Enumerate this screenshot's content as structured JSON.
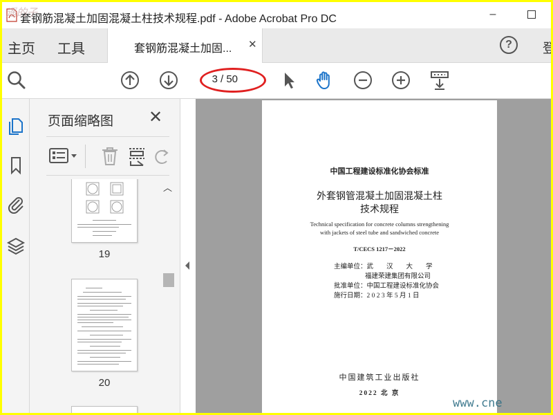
{
  "window": {
    "title": "套钢筋混凝土加固混凝土柱技术规程.pdf - Adobe Acrobat Pro DC",
    "minimize_glyph": "–",
    "watermark_left": "遥的子"
  },
  "tabs": {
    "home": "主页",
    "tools": "工具",
    "document_tab": "套钢筋混凝土加固...",
    "close_glyph": "✕",
    "help_glyph": "?",
    "signin_partial": "登"
  },
  "toolbar": {
    "page_current": "3",
    "page_total": "/ 50",
    "icons": [
      "search-icon",
      "page-up-icon",
      "page-down-icon",
      "select-cursor-icon",
      "hand-tool-icon",
      "zoom-out-icon",
      "zoom-in-icon",
      "scroll-mode-icon"
    ],
    "accent_color": "#1a73c9",
    "highlight_color": "#e02020"
  },
  "rail": {
    "icons": [
      "pages-icon",
      "bookmark-icon",
      "attachment-icon",
      "layers-icon"
    ]
  },
  "thumbnails": {
    "title": "页面缩略图",
    "close_glyph": "✕",
    "pages": [
      {
        "number": "19"
      },
      {
        "number": "20"
      }
    ]
  },
  "document": {
    "association": "中国工程建设标准化协会标准",
    "title_line1": "外套钢管混凝土加固混凝土柱",
    "title_line2": "技术规程",
    "english_line1": "Technical specification for concrete columns strengthening",
    "english_line2": "with jackets of steel tube and sandwiched concrete",
    "code": "T/CECS 1217－2022",
    "editor_label": "主编单位：",
    "editor_1": "武　　汉　　大　　学",
    "editor_2": "福建荣建集团有限公司",
    "approver_label": "批准单位：",
    "approver": "中国工程建设标准化协会",
    "date_label": "施行日期：",
    "date": "2 0 2 3 年 5 月 1 日",
    "publisher": "中国建筑工业出版社",
    "year_place": "2022  北  京"
  },
  "watermark_right": "www.cne"
}
